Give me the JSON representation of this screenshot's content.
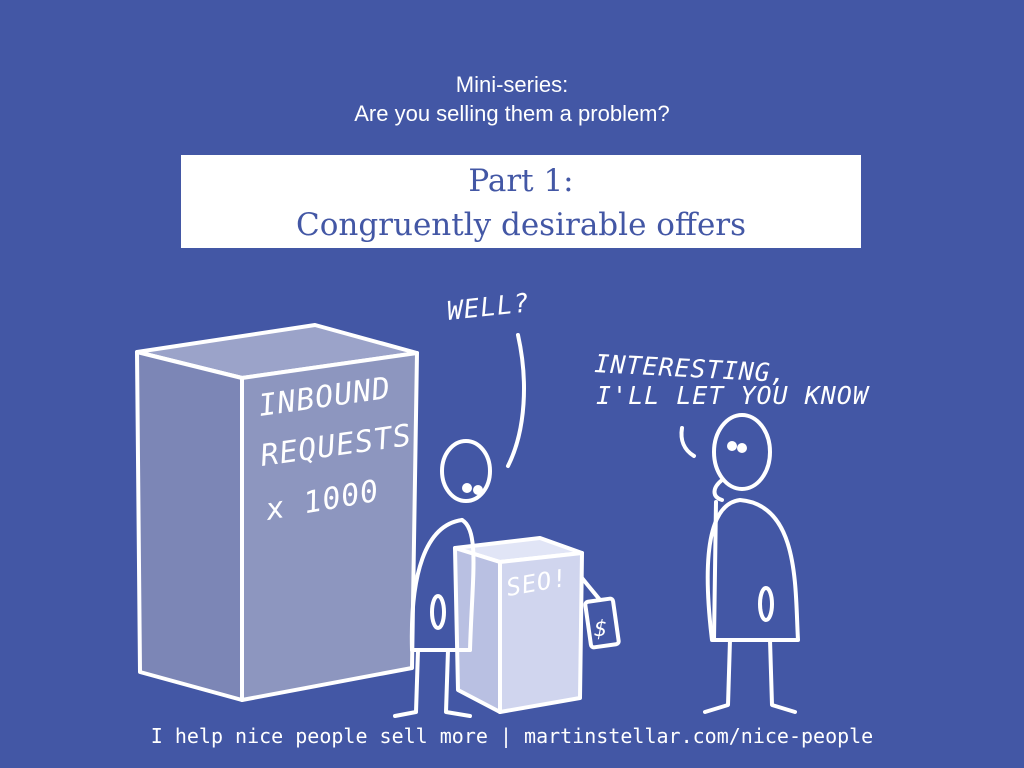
{
  "header": {
    "line1": "Mini-series:",
    "line2": "Are you selling them a problem?"
  },
  "title": {
    "line1": "Part 1:",
    "line2": "Congruently desirable offers"
  },
  "illustration": {
    "big_box_label": [
      "INBOUND",
      "REQUESTS",
      "x 1000"
    ],
    "small_box_label": "SEO!",
    "price_tag": "$",
    "speech_left": "WELL?",
    "speech_right": [
      "INTERESTING,",
      "I'LL LET YOU KNOW"
    ]
  },
  "footer": {
    "text": "I help nice people sell more | martinstellar.com/nice-people"
  },
  "colors": {
    "background": "#4357a5",
    "title_box": "#ffffff",
    "title_text": "#4357a5",
    "big_box_fill": "#8d96bf",
    "small_box_fill": "#d0d5ee"
  }
}
